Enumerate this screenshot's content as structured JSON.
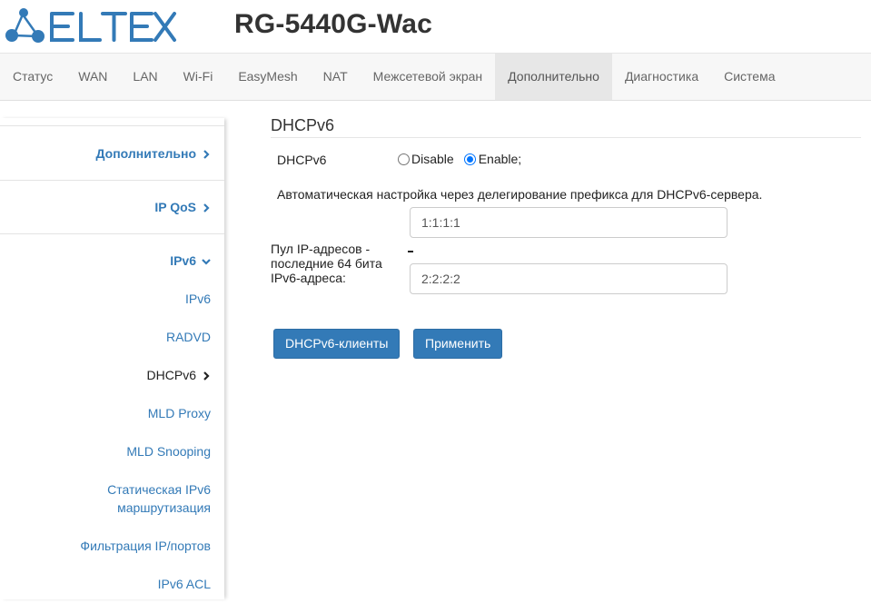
{
  "header": {
    "logo_text": "ELTEX",
    "product": "RG-5440G-Wac",
    "brand_color": "#337ab7"
  },
  "nav": {
    "items": [
      {
        "label": "Статус"
      },
      {
        "label": "WAN"
      },
      {
        "label": "LAN"
      },
      {
        "label": "Wi-Fi"
      },
      {
        "label": "EasyMesh"
      },
      {
        "label": "NAT"
      },
      {
        "label": "Межсетевой экран"
      },
      {
        "label": "Дополнительно",
        "active": true
      },
      {
        "label": "Диагностика"
      },
      {
        "label": "Система"
      }
    ]
  },
  "sidebar": {
    "groups": {
      "advanced": {
        "label": "Дополнительно",
        "icon": "chevron-right-icon"
      },
      "ipqos": {
        "label": "IP QoS",
        "icon": "chevron-right-icon"
      },
      "ipv6": {
        "label": "IPv6",
        "icon": "chevron-down-icon"
      }
    },
    "items": {
      "ipv6": "IPv6",
      "radvd": "RADVD",
      "dhcpv6": "DHCPv6",
      "mld_proxy": "MLD Proxy",
      "mld_snooping": "MLD Snooping",
      "static_routing_line1": "Статическая IPv6",
      "static_routing_line2": "маршрутизация",
      "filter": "Фильтрация IP/портов",
      "acl": "IPv6 ACL"
    }
  },
  "main": {
    "title": "DHCPv6",
    "dhcpv6_label": "DHCPv6",
    "radio_disable": "Disable",
    "radio_enable": "Enable;",
    "selected": "Enable",
    "description": "Автоматическая настройка через делегирование префикса для DHCPv6-сервера.",
    "pool_label": "Пул IP-адресов - последние 64 бита IPv6-адреса:",
    "pool_start": "1:1:1:1",
    "pool_end": "2:2:2:2",
    "clients_button": "DHCPv6-клиенты",
    "apply_button": "Применить"
  }
}
